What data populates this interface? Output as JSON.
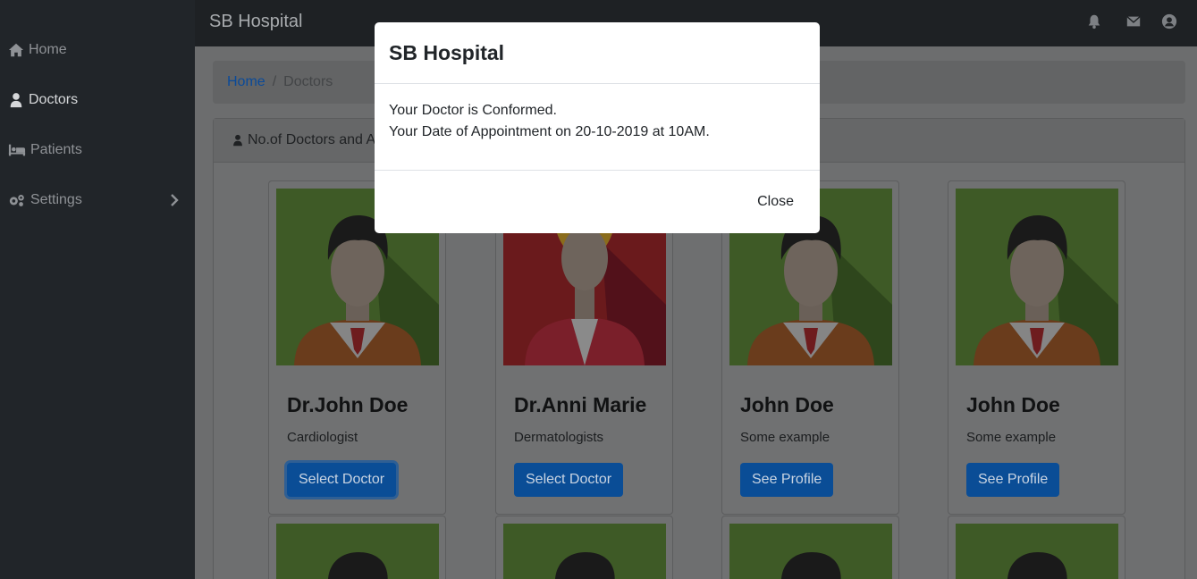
{
  "sidebar": {
    "items": [
      {
        "label": "Home",
        "icon": "home-icon"
      },
      {
        "label": "Doctors",
        "icon": "doctor-icon"
      },
      {
        "label": "Patients",
        "icon": "bed-icon"
      },
      {
        "label": "Settings",
        "icon": "gears-icon"
      }
    ]
  },
  "topbar": {
    "brand": "SB Hospital",
    "icons": [
      "bell-icon",
      "envelope-icon",
      "user-circle-icon"
    ]
  },
  "breadcrumb": {
    "home": "Home",
    "separator": "/",
    "current": "Doctors"
  },
  "card_header": {
    "title": "No.of Doctors and A"
  },
  "doctors": [
    {
      "name": "Dr.John Doe",
      "role": "Cardiologist",
      "button": "Select Doctor",
      "avatar": "male-green"
    },
    {
      "name": "Dr.Anni Marie",
      "role": "Dermatologists",
      "button": "Select Doctor",
      "avatar": "female-red"
    },
    {
      "name": "John Doe",
      "role": "Some example",
      "button": "See Profile",
      "avatar": "male-green"
    },
    {
      "name": "John Doe",
      "role": "Some example",
      "button": "See Profile",
      "avatar": "male-green"
    }
  ],
  "modal": {
    "title": "SB Hospital",
    "line1": "Your Doctor is Conformed.",
    "line2": "Your Date of Appointment on 20-10-2019 at 10AM.",
    "close": "Close"
  },
  "colors": {
    "sidebar_bg": "#212529",
    "primary_button": "#0d6efd",
    "avatar_green": "#6aa23a",
    "avatar_red": "#b3242b"
  }
}
